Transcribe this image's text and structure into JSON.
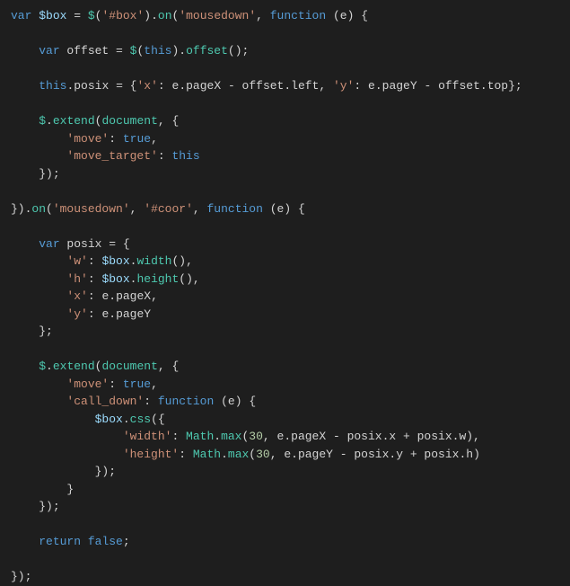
{
  "code": {
    "l01": {
      "kw_var": "var",
      "v_box": "$box",
      "eq": " = ",
      "fn_jq": "$",
      "p1": "(",
      "s_box": "'#box'",
      "p2": ").",
      "fn_on": "on",
      "p3": "(",
      "s_md": "'mousedown'",
      "c1": ", ",
      "kw_fn": "function",
      "sp": " ",
      "p4": "(",
      "v_e": "e",
      "p5": ") {"
    },
    "l03": {
      "pad": "    ",
      "kw_var": "var",
      "v_off": " offset = ",
      "fn_jq": "$",
      "p1": "(",
      "this": "this",
      "p2": ").",
      "fn_off": "offset",
      "p3": "();"
    },
    "l05": {
      "pad": "    ",
      "this": "this",
      "dot": ".",
      "prop": "posix",
      "eq": " = {",
      "s_x": "'x'",
      "c1": ": ",
      "v_e1": "e",
      "d1": ".",
      "p_px": "pageX",
      "m1": " - ",
      "v_o1": "offset",
      "d2": ".",
      "p_l": "left",
      "c2": ", ",
      "s_y": "'y'",
      "c3": ": ",
      "v_e2": "e",
      "d3": ".",
      "p_py": "pageY",
      "m2": " - ",
      "v_o2": "offset",
      "d4": ".",
      "p_t": "top",
      "end": "};"
    },
    "l07": {
      "pad": "    ",
      "fn_jq": "$",
      "d": ".",
      "fn_ext": "extend",
      "p1": "(",
      "obj": "document",
      "c": ", {"
    },
    "l08": {
      "pad": "        ",
      "s": "'move'",
      "c": ": ",
      "b": "true",
      "e": ","
    },
    "l09": {
      "pad": "        ",
      "s": "'move_target'",
      "c": ": ",
      "this": "this"
    },
    "l10": {
      "pad": "    ",
      "e": "});"
    },
    "l12": {
      "p1": "}).",
      "fn_on": "on",
      "p2": "(",
      "s_md": "'mousedown'",
      "c1": ", ",
      "s_c": "'#coor'",
      "c2": ", ",
      "kw_fn": "function",
      "sp": " ",
      "p3": "(",
      "v_e": "e",
      "p4": ") {"
    },
    "l14": {
      "pad": "    ",
      "kw_var": "var",
      "v": " posix = {"
    },
    "l15": {
      "pad": "        ",
      "s": "'w'",
      "c": ": ",
      "v": "$box",
      "d": ".",
      "fn": "width",
      "e": "(),"
    },
    "l16": {
      "pad": "        ",
      "s": "'h'",
      "c": ": ",
      "v": "$box",
      "d": ".",
      "fn": "height",
      "e": "(),"
    },
    "l17": {
      "pad": "        ",
      "s": "'x'",
      "c": ": ",
      "v": "e",
      "d": ".",
      "p": "pageX",
      "e": ","
    },
    "l18": {
      "pad": "        ",
      "s": "'y'",
      "c": ": ",
      "v": "e",
      "d": ".",
      "p": "pageY"
    },
    "l19": {
      "pad": "    ",
      "e": "};"
    },
    "l21": {
      "pad": "    ",
      "fn_jq": "$",
      "d": ".",
      "fn_ext": "extend",
      "p1": "(",
      "obj": "document",
      "c": ", {"
    },
    "l22": {
      "pad": "        ",
      "s": "'move'",
      "c": ": ",
      "b": "true",
      "e": ","
    },
    "l23": {
      "pad": "        ",
      "s": "'call_down'",
      "c": ": ",
      "kw_fn": "function",
      "sp": " ",
      "p1": "(",
      "v_e": "e",
      "p2": ") {"
    },
    "l24": {
      "pad": "            ",
      "v": "$box",
      "d": ".",
      "fn": "css",
      "p": "({"
    },
    "l25": {
      "pad": "                ",
      "s": "'width'",
      "c": ": ",
      "obj": "Math",
      "d": ".",
      "fn": "max",
      "p1": "(",
      "n": "30",
      "c1": ", ",
      "v_e": "e",
      "d1": ".",
      "px": "pageX",
      "m1": " - ",
      "v_p1": "posix",
      "d2": ".",
      "x": "x",
      "pl": " + ",
      "v_p2": "posix",
      "d3": ".",
      "w": "w",
      "p2": "),"
    },
    "l26": {
      "pad": "                ",
      "s": "'height'",
      "c": ": ",
      "obj": "Math",
      "d": ".",
      "fn": "max",
      "p1": "(",
      "n": "30",
      "c1": ", ",
      "v_e": "e",
      "d1": ".",
      "py": "pageY",
      "m1": " - ",
      "v_p1": "posix",
      "d2": ".",
      "y": "y",
      "pl": " + ",
      "v_p2": "posix",
      "d3": ".",
      "h": "h",
      "p2": ")"
    },
    "l27": {
      "pad": "            ",
      "e": "});"
    },
    "l28": {
      "pad": "        ",
      "e": "}"
    },
    "l29": {
      "pad": "    ",
      "e": "});"
    },
    "l31": {
      "pad": "    ",
      "kw": "return",
      "sp": " ",
      "b": "false",
      "e": ";"
    },
    "l33": {
      "e": "});"
    }
  }
}
